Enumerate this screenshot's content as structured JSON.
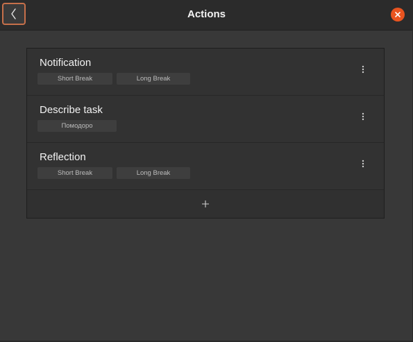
{
  "window": {
    "title": "Actions"
  },
  "header": {
    "back_icon": "chevron-left-icon",
    "close_icon": "close-icon",
    "accent_color": "#e95420",
    "focus_color": "#c7704a"
  },
  "actions": [
    {
      "title": "Notification",
      "tags": [
        "Short Break",
        "Long Break"
      ]
    },
    {
      "title": "Describe task",
      "tags": [
        "Помодоро"
      ]
    },
    {
      "title": "Reflection",
      "tags": [
        "Short Break",
        "Long Break"
      ]
    }
  ],
  "add_icon": "plus-icon",
  "menu_icon": "vertical-dots-icon"
}
